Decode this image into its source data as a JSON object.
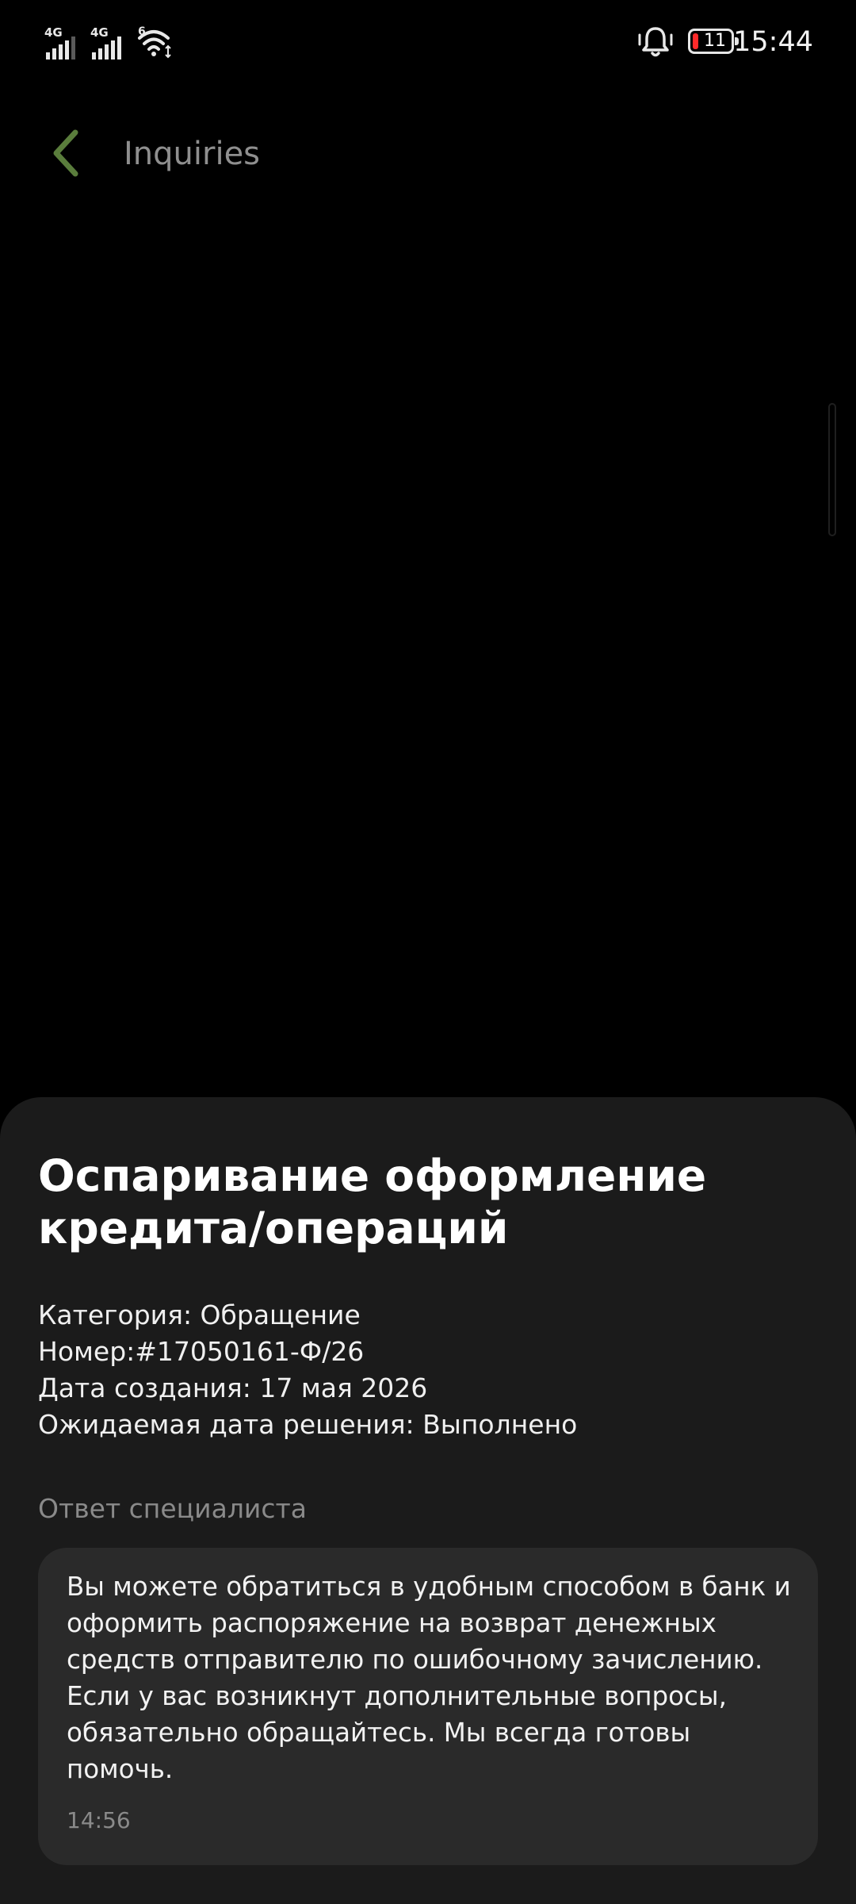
{
  "status_bar": {
    "network_1": "4G",
    "network_2": "4G",
    "wifi_label": "6",
    "battery_level": "11",
    "time": "15:44"
  },
  "header": {
    "title": "Inquiries",
    "back_icon": "chevron-left-icon"
  },
  "colors": {
    "accent": "#5a7d3c",
    "sheet_background": "#1b1b1b",
    "card_background": "#2a2a2a",
    "battery_low": "#ff2a2a"
  },
  "inquiry": {
    "title": "Оспаривание оформление кредита/операций",
    "category": "Категория: Обращение",
    "number": "Номер:#17050161-Ф/26",
    "created": "Дата создания: 17 мая 2026",
    "expected": "Ожидаемая дата решения: Выполнено"
  },
  "response": {
    "label": "Ответ специалиста",
    "text": "Вы можете обратиться в удобным способом в банк и оформить распоряжение на возврат денежных средств отправителю по ошибочному зачислению. Если у вас возникнут дополнительные вопросы, обязательно обращайтесь. Мы всегда готовы помочь.",
    "time": "14:56"
  }
}
